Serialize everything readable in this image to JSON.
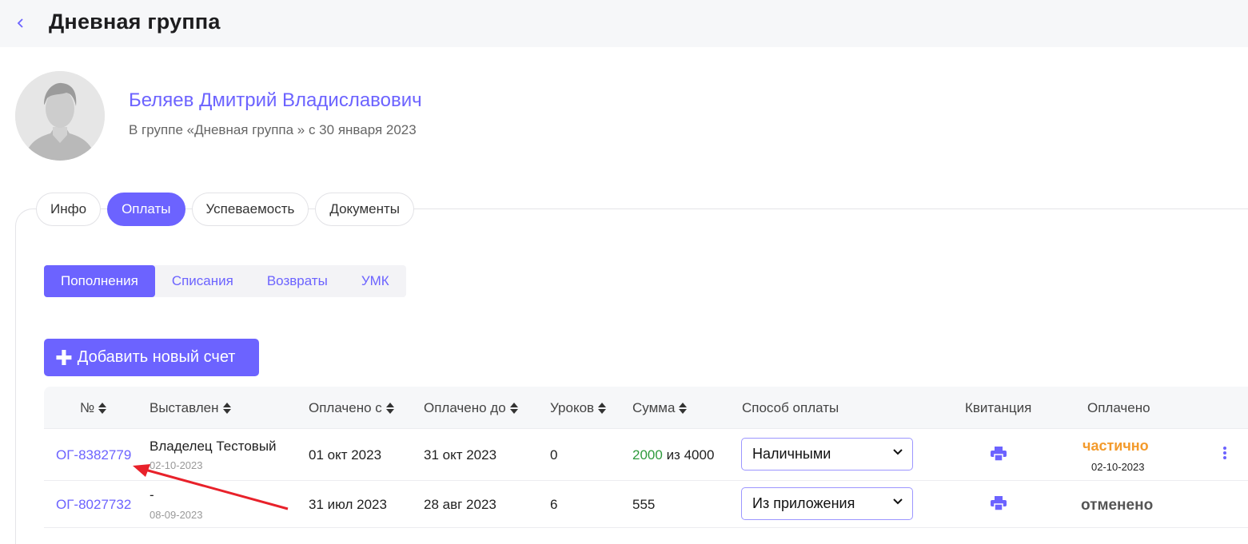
{
  "header": {
    "title": "Дневная группа"
  },
  "student": {
    "name": "Беляев Дмитрий Владиславович",
    "subtitle": "В группе «Дневная группа » с 30 января 2023"
  },
  "tabs": [
    {
      "label": "Инфо",
      "active": false
    },
    {
      "label": "Оплаты",
      "active": true
    },
    {
      "label": "Успеваемость",
      "active": false
    },
    {
      "label": "Документы",
      "active": false
    }
  ],
  "subtabs": [
    {
      "label": "Пополнения",
      "active": true
    },
    {
      "label": "Списания",
      "active": false
    },
    {
      "label": "Возвраты",
      "active": false
    },
    {
      "label": "УМК",
      "active": false
    }
  ],
  "add_button": {
    "label": "Добавить новый счет"
  },
  "table": {
    "columns": {
      "number": "№",
      "issued": "Выставлен",
      "paid_from": "Оплачено с",
      "paid_to": "Оплачено до",
      "lessons": "Уроков",
      "amount": "Сумма",
      "method": "Способ оплаты",
      "receipt": "Квитанция",
      "paid": "Оплачено"
    },
    "rows": [
      {
        "number": "ОГ-8382779",
        "issued_by": "Владелец Тестовый",
        "issued_date": "02-10-2023",
        "paid_from": "01 окт 2023",
        "paid_to": "31 окт 2023",
        "lessons": "0",
        "amount_paid": "2000",
        "amount_of": "из 4000",
        "method": "Наличными",
        "status": "частично",
        "status_date": "02-10-2023"
      },
      {
        "number": "ОГ-8027732",
        "issued_by": "-",
        "issued_date": "08-09-2023",
        "paid_from": "31 июл 2023",
        "paid_to": "28 авг 2023",
        "lessons": "6",
        "amount": "555",
        "method": "Из приложения",
        "status": "отменено"
      }
    ]
  },
  "colors": {
    "accent": "#6c63ff",
    "partial": "#f39a2b",
    "paid_green": "#2e9a3c",
    "annotation_arrow": "#e8212a"
  }
}
